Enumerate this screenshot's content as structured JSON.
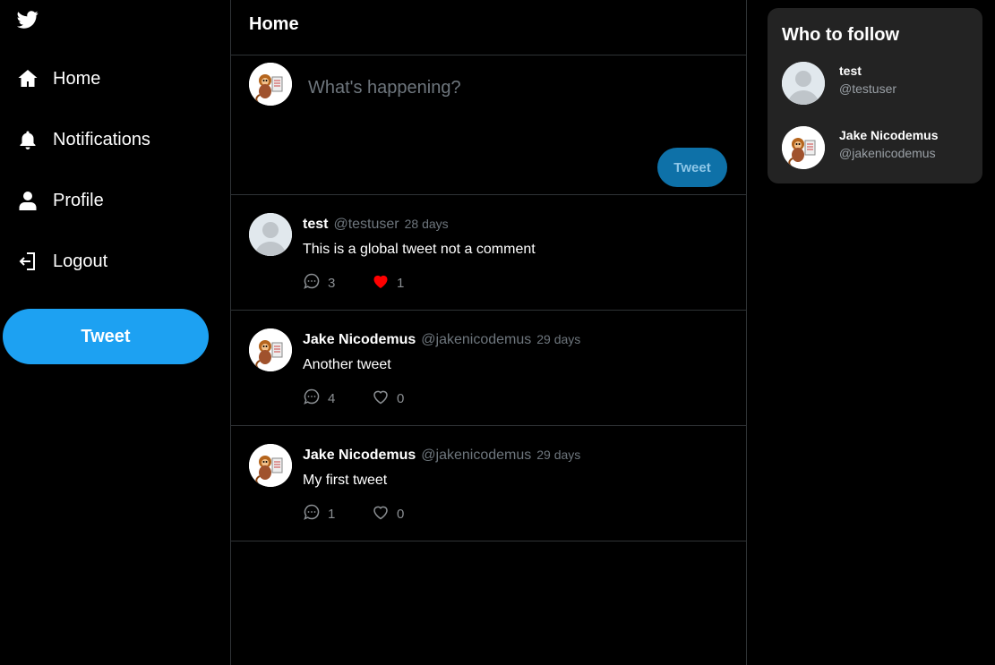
{
  "colors": {
    "accent": "#1da1f2",
    "background": "#000000",
    "like_active": "#ff0000"
  },
  "sidebar": {
    "logo_icon": "twitter-bird-icon",
    "items": [
      {
        "label": "Home",
        "icon": "home-icon"
      },
      {
        "label": "Notifications",
        "icon": "bell-icon"
      },
      {
        "label": "Profile",
        "icon": "user-icon"
      },
      {
        "label": "Logout",
        "icon": "logout-icon"
      }
    ],
    "tweet_button": "Tweet"
  },
  "main": {
    "title": "Home",
    "composer": {
      "placeholder": "What's happening?",
      "submit_label": "Tweet"
    },
    "tweets": [
      {
        "name": "test",
        "handle": "@testuser",
        "time": "28 days",
        "text": "This is a global tweet not a comment",
        "comments": "3",
        "likes": "1",
        "liked": true,
        "avatar": "default-avatar"
      },
      {
        "name": "Jake Nicodemus",
        "handle": "@jakenicodemus",
        "time": "29 days",
        "text": "Another tweet",
        "comments": "4",
        "likes": "0",
        "liked": false,
        "avatar": "monkey-avatar"
      },
      {
        "name": "Jake Nicodemus",
        "handle": "@jakenicodemus",
        "time": "29 days",
        "text": "My first tweet",
        "comments": "1",
        "likes": "0",
        "liked": false,
        "avatar": "monkey-avatar"
      }
    ]
  },
  "who_to_follow": {
    "title": "Who to follow",
    "users": [
      {
        "name": "test",
        "handle": "@testuser",
        "avatar": "default-avatar"
      },
      {
        "name": "Jake Nicodemus",
        "handle": "@jakenicodemus",
        "avatar": "monkey-avatar"
      }
    ]
  }
}
